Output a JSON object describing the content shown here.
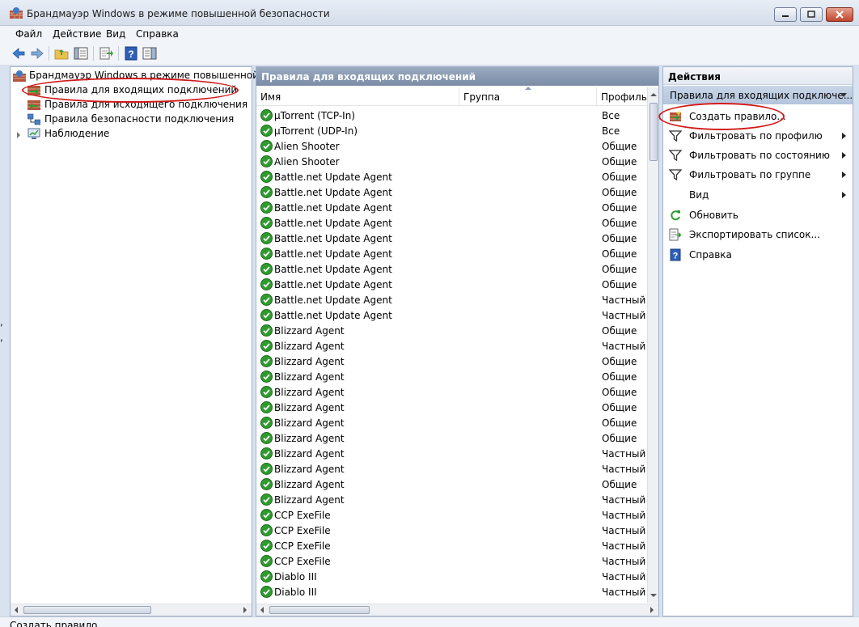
{
  "window": {
    "title": "Брандмауэр Windows в режиме повышенной безопасности"
  },
  "menu": [
    "Файл",
    "Действие",
    "Вид",
    "Справка"
  ],
  "tree": {
    "root": "Брандмауэр Windows в режиме повышенной без",
    "items": [
      {
        "label": "Правила для входящих подключений",
        "icon": "inbound-rules-icon"
      },
      {
        "label": "Правила для исходящего подключения",
        "icon": "outbound-rules-icon"
      },
      {
        "label": "Правила безопасности подключения",
        "icon": "connection-security-icon"
      },
      {
        "label": "Наблюдение",
        "icon": "monitoring-icon"
      }
    ]
  },
  "center": {
    "title": "Правила для входящих подключений",
    "columns": {
      "name": "Имя",
      "group": "Группа",
      "profile": "Профиль"
    },
    "rules": [
      {
        "name": "µTorrent (TCP-In)",
        "profile": "Все"
      },
      {
        "name": "µTorrent (UDP-In)",
        "profile": "Все"
      },
      {
        "name": "Alien Shooter",
        "profile": "Общие"
      },
      {
        "name": "Alien Shooter",
        "profile": "Общие"
      },
      {
        "name": "Battle.net Update Agent",
        "profile": "Общие"
      },
      {
        "name": "Battle.net Update Agent",
        "profile": "Общие"
      },
      {
        "name": "Battle.net Update Agent",
        "profile": "Общие"
      },
      {
        "name": "Battle.net Update Agent",
        "profile": "Общие"
      },
      {
        "name": "Battle.net Update Agent",
        "profile": "Общие"
      },
      {
        "name": "Battle.net Update Agent",
        "profile": "Общие"
      },
      {
        "name": "Battle.net Update Agent",
        "profile": "Общие"
      },
      {
        "name": "Battle.net Update Agent",
        "profile": "Общие"
      },
      {
        "name": "Battle.net Update Agent",
        "profile": "Частный"
      },
      {
        "name": "Battle.net Update Agent",
        "profile": "Частный"
      },
      {
        "name": "Blizzard Agent",
        "profile": "Общие"
      },
      {
        "name": "Blizzard Agent",
        "profile": "Частный"
      },
      {
        "name": "Blizzard Agent",
        "profile": "Общие"
      },
      {
        "name": "Blizzard Agent",
        "profile": "Общие"
      },
      {
        "name": "Blizzard Agent",
        "profile": "Общие"
      },
      {
        "name": "Blizzard Agent",
        "profile": "Общие"
      },
      {
        "name": "Blizzard Agent",
        "profile": "Общие"
      },
      {
        "name": "Blizzard Agent",
        "profile": "Общие"
      },
      {
        "name": "Blizzard Agent",
        "profile": "Частный"
      },
      {
        "name": "Blizzard Agent",
        "profile": "Частный"
      },
      {
        "name": "Blizzard Agent",
        "profile": "Общие"
      },
      {
        "name": "Blizzard Agent",
        "profile": "Частный"
      },
      {
        "name": "CCP ExeFile",
        "profile": "Частный"
      },
      {
        "name": "CCP ExeFile",
        "profile": "Частный"
      },
      {
        "name": "CCP ExeFile",
        "profile": "Частный"
      },
      {
        "name": "CCP ExeFile",
        "profile": "Частный"
      },
      {
        "name": "Diablo III",
        "profile": "Частный"
      },
      {
        "name": "Diablo III",
        "profile": "Частный"
      }
    ]
  },
  "actions": {
    "title": "Действия",
    "section": "Правила для входящих подключе...",
    "items": [
      {
        "label": "Создать правило...",
        "icon": "new-rule-icon",
        "submenu": false
      },
      {
        "label": "Фильтровать по профилю",
        "icon": "filter-icon",
        "submenu": true
      },
      {
        "label": "Фильтровать по состоянию",
        "icon": "filter-icon",
        "submenu": true
      },
      {
        "label": "Фильтровать по группе",
        "icon": "filter-icon",
        "submenu": true
      },
      {
        "label": "Вид",
        "icon": "",
        "submenu": true
      },
      {
        "label": "Обновить",
        "icon": "refresh-icon",
        "submenu": false
      },
      {
        "label": "Экспортировать список...",
        "icon": "export-icon",
        "submenu": false
      },
      {
        "label": "Справка",
        "icon": "help-icon",
        "submenu": false
      }
    ]
  },
  "status": {
    "text": "Создать правило"
  },
  "colors": {
    "annotation": "#d11a1a",
    "header": "#7b8ca6",
    "check": "#2f9b2f"
  }
}
